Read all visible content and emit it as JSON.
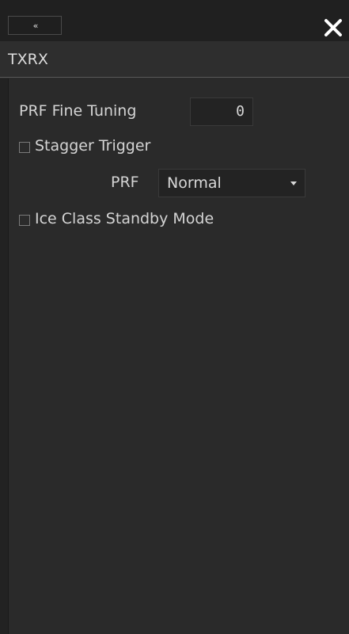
{
  "header": {
    "collapse_label": "«",
    "close_label": "✕"
  },
  "title": "TXRX",
  "prf_fine_tuning": {
    "label": "PRF Fine Tuning",
    "value": "0"
  },
  "stagger_trigger": {
    "label": "Stagger Trigger",
    "checked": false
  },
  "prf": {
    "label": "PRF",
    "selected": "Normal"
  },
  "ice_class_standby": {
    "label": "Ice Class Standby Mode",
    "checked": false
  }
}
